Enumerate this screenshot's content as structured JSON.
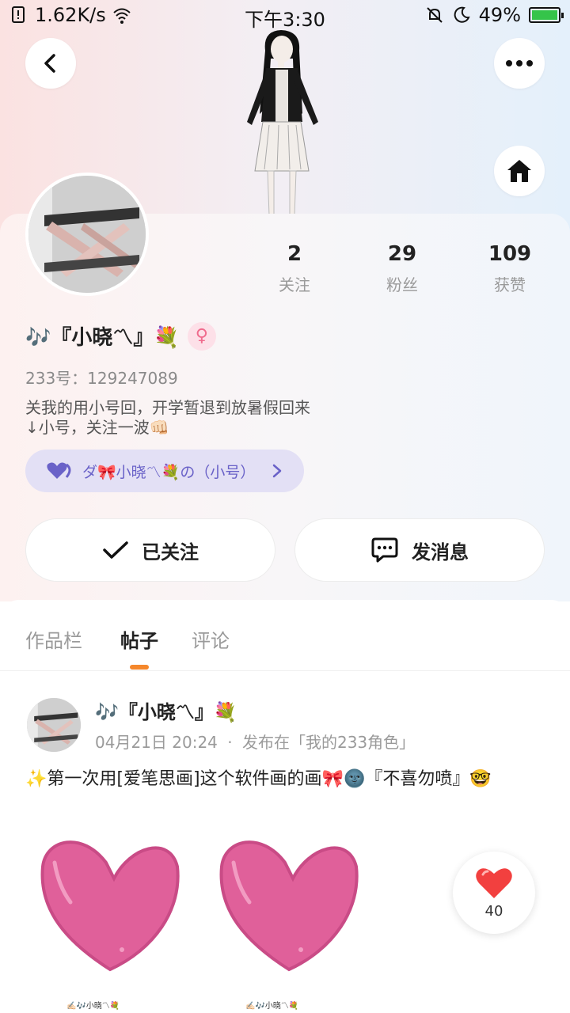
{
  "status_bar": {
    "net_speed": "1.62K/s",
    "time": "下午3:30",
    "battery": "49%"
  },
  "profile": {
    "name": "🎶『小晓〽』💐",
    "uid": "233号：129247089",
    "bio_line1": "关我的用小号回，开学暂退到放暑假回来",
    "bio_line2": "↓小号，关注一波👊🏻",
    "sub_account": "ダ🎀小晓〽💐の（小号）",
    "stats": [
      {
        "value": "2",
        "label": "关注"
      },
      {
        "value": "29",
        "label": "粉丝"
      },
      {
        "value": "109",
        "label": "获赞"
      }
    ]
  },
  "actions": {
    "follow_label": "已关注",
    "message_label": "发消息"
  },
  "tabs": [
    {
      "label": "作品栏"
    },
    {
      "label": "帖子"
    },
    {
      "label": "评论"
    }
  ],
  "post": {
    "author": "🎶『小晓〽』💐",
    "date": "04月21日 20:24",
    "separator": "·",
    "posted_in": "发布在「我的233角色」",
    "text": "✨第一次用[爱笔思画]这个软件画的画🎀🌚『不喜勿喷』🤓",
    "image_caption": "✍🏻🎶小晓〽💐",
    "likes": "40"
  },
  "colors": {
    "accent": "#f5872b",
    "sub_pill_bg": "#e3e0f5",
    "sub_pill_text": "#6a62c8",
    "heart_pink": "#e0609a"
  }
}
